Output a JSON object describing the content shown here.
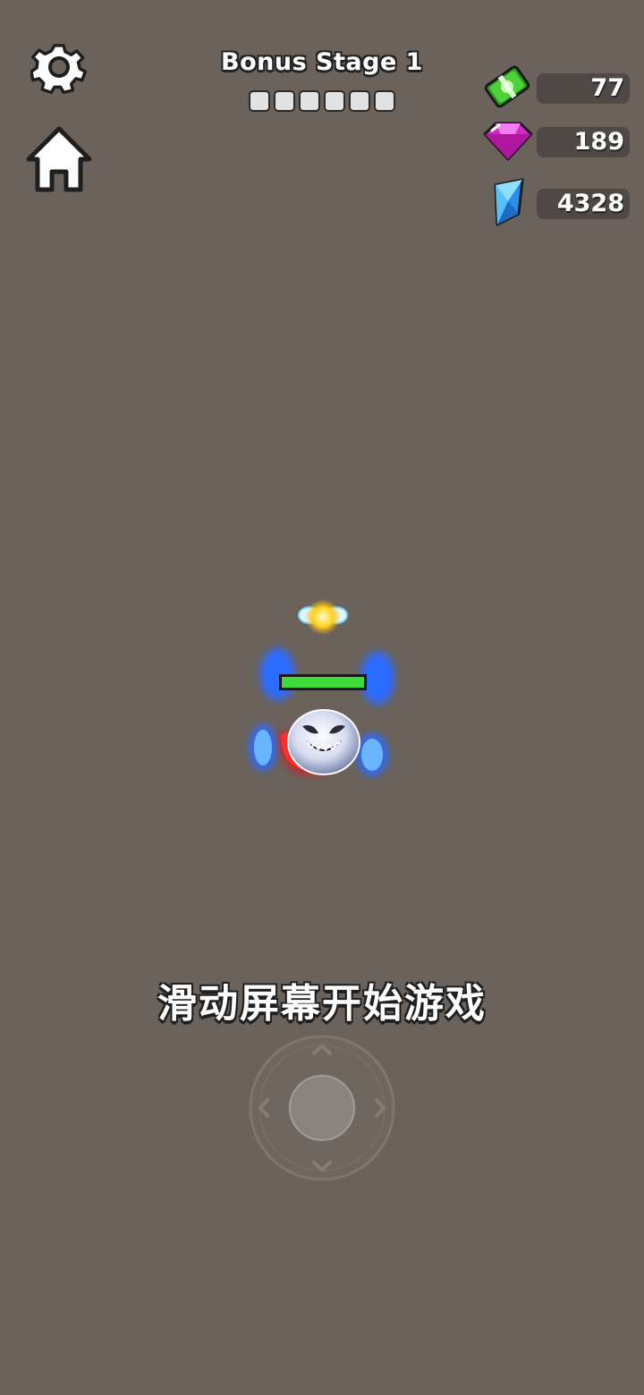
{
  "header": {
    "stage_title": "Bonus Stage 1",
    "stage_progress": {
      "total": 6,
      "filled": 0
    }
  },
  "toolbar": {
    "settings_icon": "gear-icon",
    "home_icon": "home-icon"
  },
  "currencies": [
    {
      "name": "cash",
      "icon": "cash-icon",
      "value": "77",
      "color": "#3ec52a"
    },
    {
      "name": "pink-gem",
      "icon": "pink-gem-icon",
      "value": "189",
      "color": "#e23ad6"
    },
    {
      "name": "blue-crystal",
      "icon": "blue-crystal-icon",
      "value": "4328",
      "color": "#3aa6ff"
    }
  ],
  "player": {
    "health_fraction": 1.0,
    "health_color": "#3ddc3a"
  },
  "hint": "滑动屏幕开始游戏",
  "joystick": {
    "icon": "joystick-icon"
  }
}
